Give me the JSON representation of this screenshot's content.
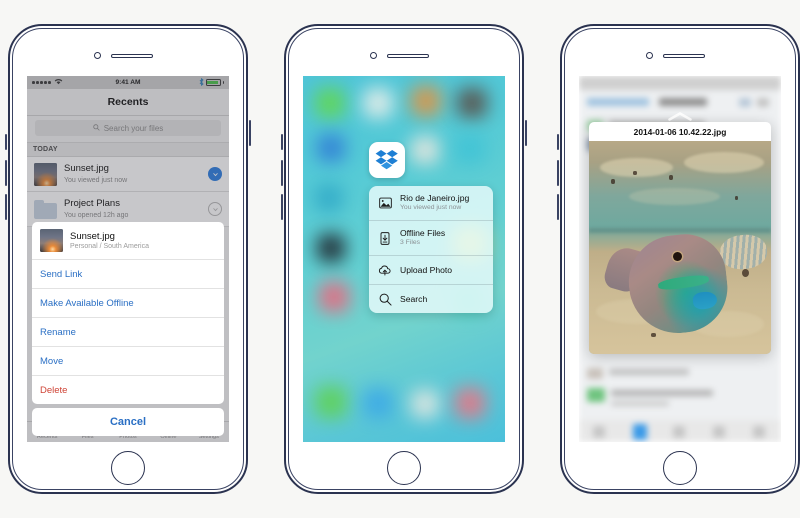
{
  "page": {
    "background_color": "#f7f7f5",
    "frame_color": "#2b3350"
  },
  "phone1": {
    "name": "dropbox-recents-action-sheet",
    "statusbar": {
      "signal_dots": 5,
      "wifi_icon": "wifi-icon",
      "time": "9:41 AM",
      "bluetooth_icon": "bluetooth-icon",
      "battery_icon": "battery-icon",
      "battery_color": "#49c24a"
    },
    "nav": {
      "title": "Recents"
    },
    "search": {
      "placeholder": "Search your files",
      "icon": "search-icon"
    },
    "section_header": "TODAY",
    "rows": [
      {
        "title": "Sunset.jpg",
        "subtitle": "You viewed just now",
        "thumb": "sunset-photo-thumbnail",
        "badge": "chevron-down-icon",
        "badge_color": "#2a7de1"
      },
      {
        "title": "Project Plans",
        "subtitle": "You opened 12h ago",
        "thumb": "folder-icon",
        "badge": "chevron-down-icon",
        "badge_color": "#b9b9b9"
      }
    ],
    "action_sheet": {
      "header_title": "Sunset.jpg",
      "header_subtitle": "Personal / South America",
      "header_thumb": "sunset-photo-thumbnail",
      "items": [
        {
          "label": "Send Link",
          "style": "default"
        },
        {
          "label": "Make Available Offline",
          "style": "default"
        },
        {
          "label": "Rename",
          "style": "default"
        },
        {
          "label": "Move",
          "style": "default"
        },
        {
          "label": "Delete",
          "style": "destructive"
        }
      ],
      "cancel_label": "Cancel",
      "accent_color": "#2a6fc4",
      "destructive_color": "#cf4436"
    },
    "tabbar": [
      {
        "label": "Recents"
      },
      {
        "label": "Files"
      },
      {
        "label": "Photos"
      },
      {
        "label": "Offline"
      },
      {
        "label": "Settings"
      }
    ]
  },
  "phone2": {
    "name": "dropbox-3d-touch-quick-actions",
    "app_icon": "dropbox-icon",
    "app_icon_color": "#1e7fd4",
    "quick_actions": [
      {
        "title": "Rio de Janeiro.jpg",
        "subtitle": "You viewed just now",
        "icon": "photo-icon"
      },
      {
        "title": "Offline Files",
        "subtitle": "3 Files",
        "icon": "offline-device-icon"
      },
      {
        "title": "Upload Photo",
        "subtitle": "",
        "icon": "upload-cloud-icon"
      },
      {
        "title": "Search",
        "subtitle": "",
        "icon": "search-icon"
      }
    ]
  },
  "phone3": {
    "name": "dropbox-peek-photo-preview",
    "peek_handle_icon": "chevron-up-icon",
    "preview": {
      "filename": "2014-01-06 10.42.22.jpg",
      "image": "underwater-parrotfish-photo"
    }
  }
}
